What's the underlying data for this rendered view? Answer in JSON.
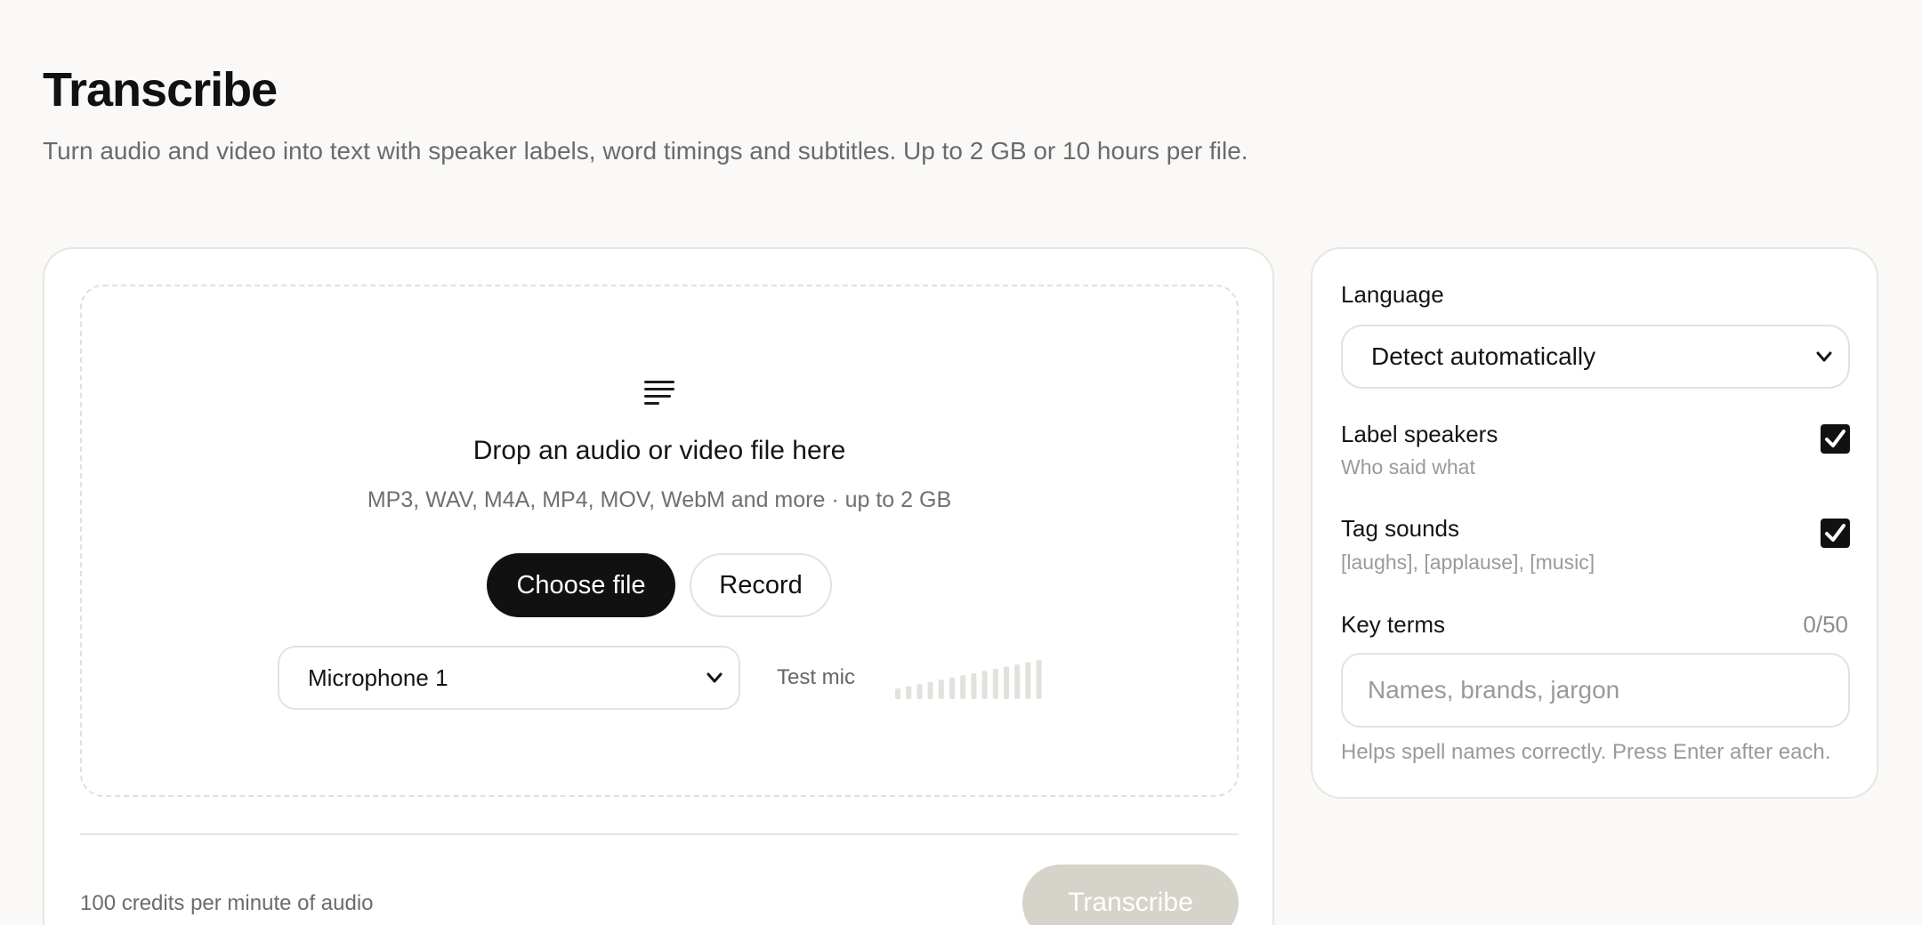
{
  "page": {
    "title": "Transcribe",
    "subtitle": "Turn audio and video into text with speaker labels, word timings and subtitles. Up to 2 GB or 10 hours per file."
  },
  "upload": {
    "icon": "document-lines-icon",
    "title": "Drop an audio or video file here",
    "formats": "MP3, WAV, M4A, MP4, MOV, WebM and more · up to 2 GB",
    "choose_label": "Choose file",
    "record_label": "Record",
    "microphone": {
      "selected": "Microphone 1"
    },
    "test_mic_label": "Test mic",
    "meter_bar_count": 14
  },
  "footer": {
    "credits": "100 credits per minute of audio",
    "transcribe_label": "Transcribe",
    "transcribe_enabled": false
  },
  "settings": {
    "language": {
      "label": "Language",
      "selected": "Detect automatically"
    },
    "label_speakers": {
      "title": "Label speakers",
      "description": "Who said what",
      "checked": true
    },
    "tag_sounds": {
      "title": "Tag sounds",
      "description": "[laughs], [applause], [music]",
      "checked": true
    },
    "key_terms": {
      "label": "Key terms",
      "count": "0/50",
      "placeholder": "Names, brands, jargon",
      "value": "",
      "help": "Helps spell names correctly. Press Enter after each."
    }
  },
  "colors": {
    "background": "#faf9f7",
    "primary": "#111111",
    "disabled_button": "#d6d3cb",
    "border": "#e4e2dd",
    "muted_text": "#6b6b6b"
  }
}
